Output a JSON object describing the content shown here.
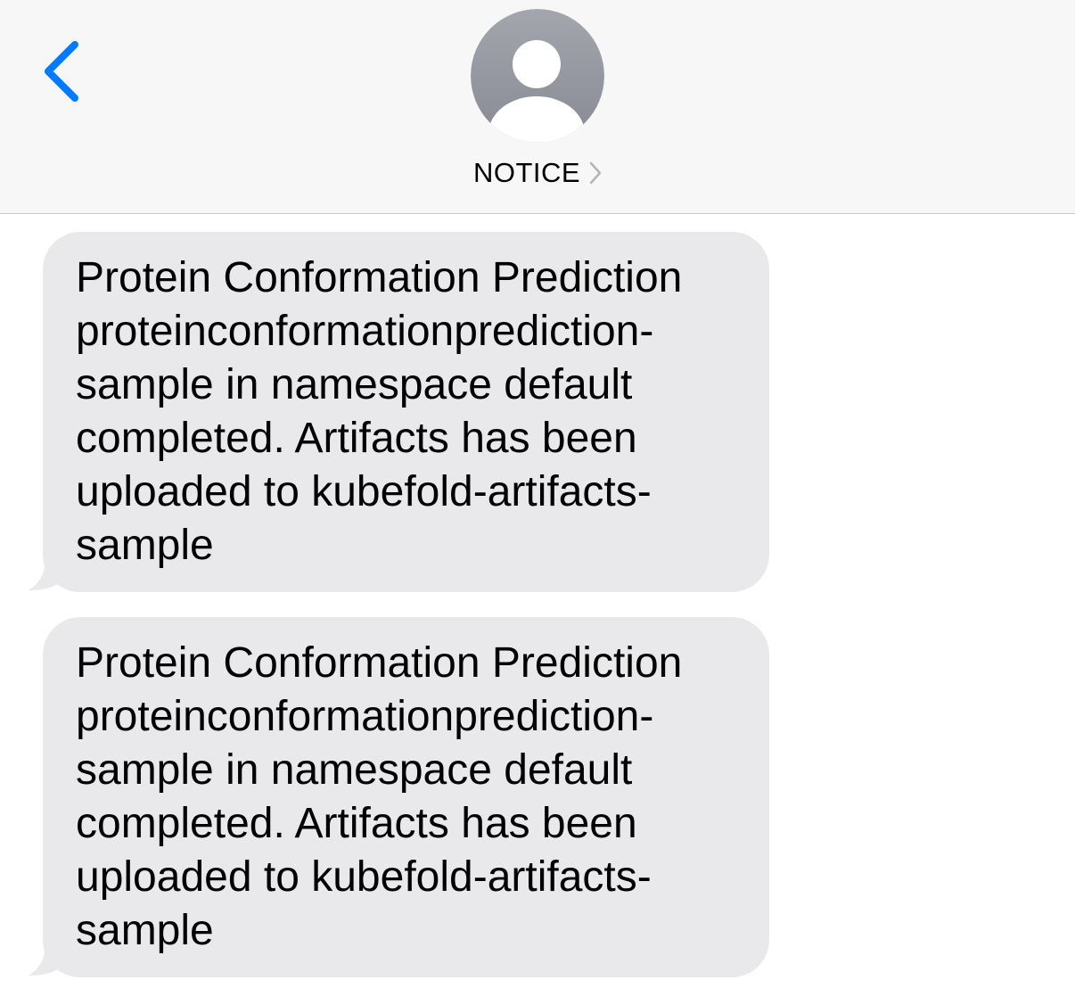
{
  "header": {
    "contact_name": "NOTICE",
    "back_icon": "chevron-left-icon",
    "avatar_icon": "person-silhouette-icon",
    "disclosure_icon": "chevron-right-icon",
    "accent_color": "#007aff"
  },
  "messages": [
    {
      "text": "Protein Conformation Prediction proteinconformationprediction-sample in namespace default completed. Artifacts has been uploaded to kubefold-artifacts-sample",
      "direction": "incoming"
    },
    {
      "text": "Protein Conformation Prediction proteinconformationprediction-sample in namespace default completed. Artifacts has been uploaded to kubefold-artifacts-sample",
      "direction": "incoming"
    }
  ]
}
